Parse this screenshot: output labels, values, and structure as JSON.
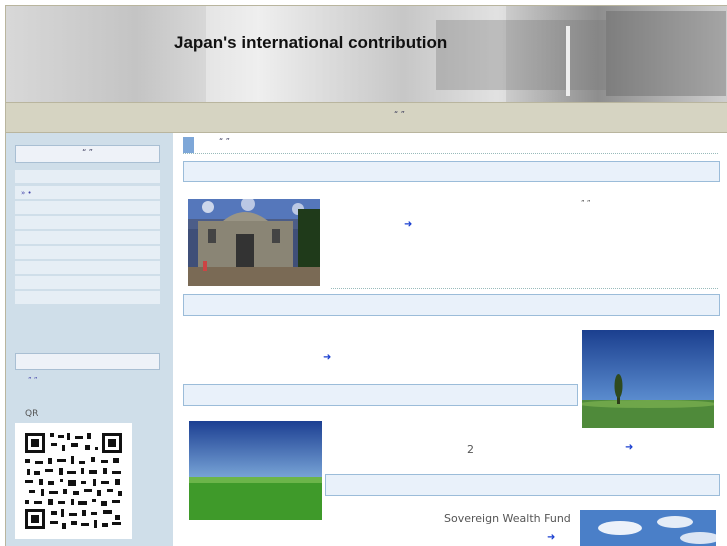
{
  "header": {
    "title": "Japan's international contribution"
  },
  "nav": {
    "text": "“   ”"
  },
  "sidebar": {
    "heading": "“        ”",
    "items": [
      {
        "label": ""
      },
      {
        "label": "» •"
      },
      {
        "label": ""
      },
      {
        "label": ""
      },
      {
        "label": ""
      },
      {
        "label": ""
      },
      {
        "label": ""
      },
      {
        "label": ""
      },
      {
        "label": ""
      }
    ],
    "link": "”   ”",
    "qr_label": "QR"
  },
  "main": {
    "section_title": "“        ”",
    "quote_mark": "”  ”",
    "number_text": "2",
    "fund_text": "Sovereign Wealth Fund",
    "arrow": "➜"
  },
  "colors": {
    "accent": "#7ea7d8",
    "bar_border": "#9bbcd9",
    "arrow": "#1a3fd0",
    "sidebar": "#cfdee9",
    "nav": "#d6d4c2"
  }
}
